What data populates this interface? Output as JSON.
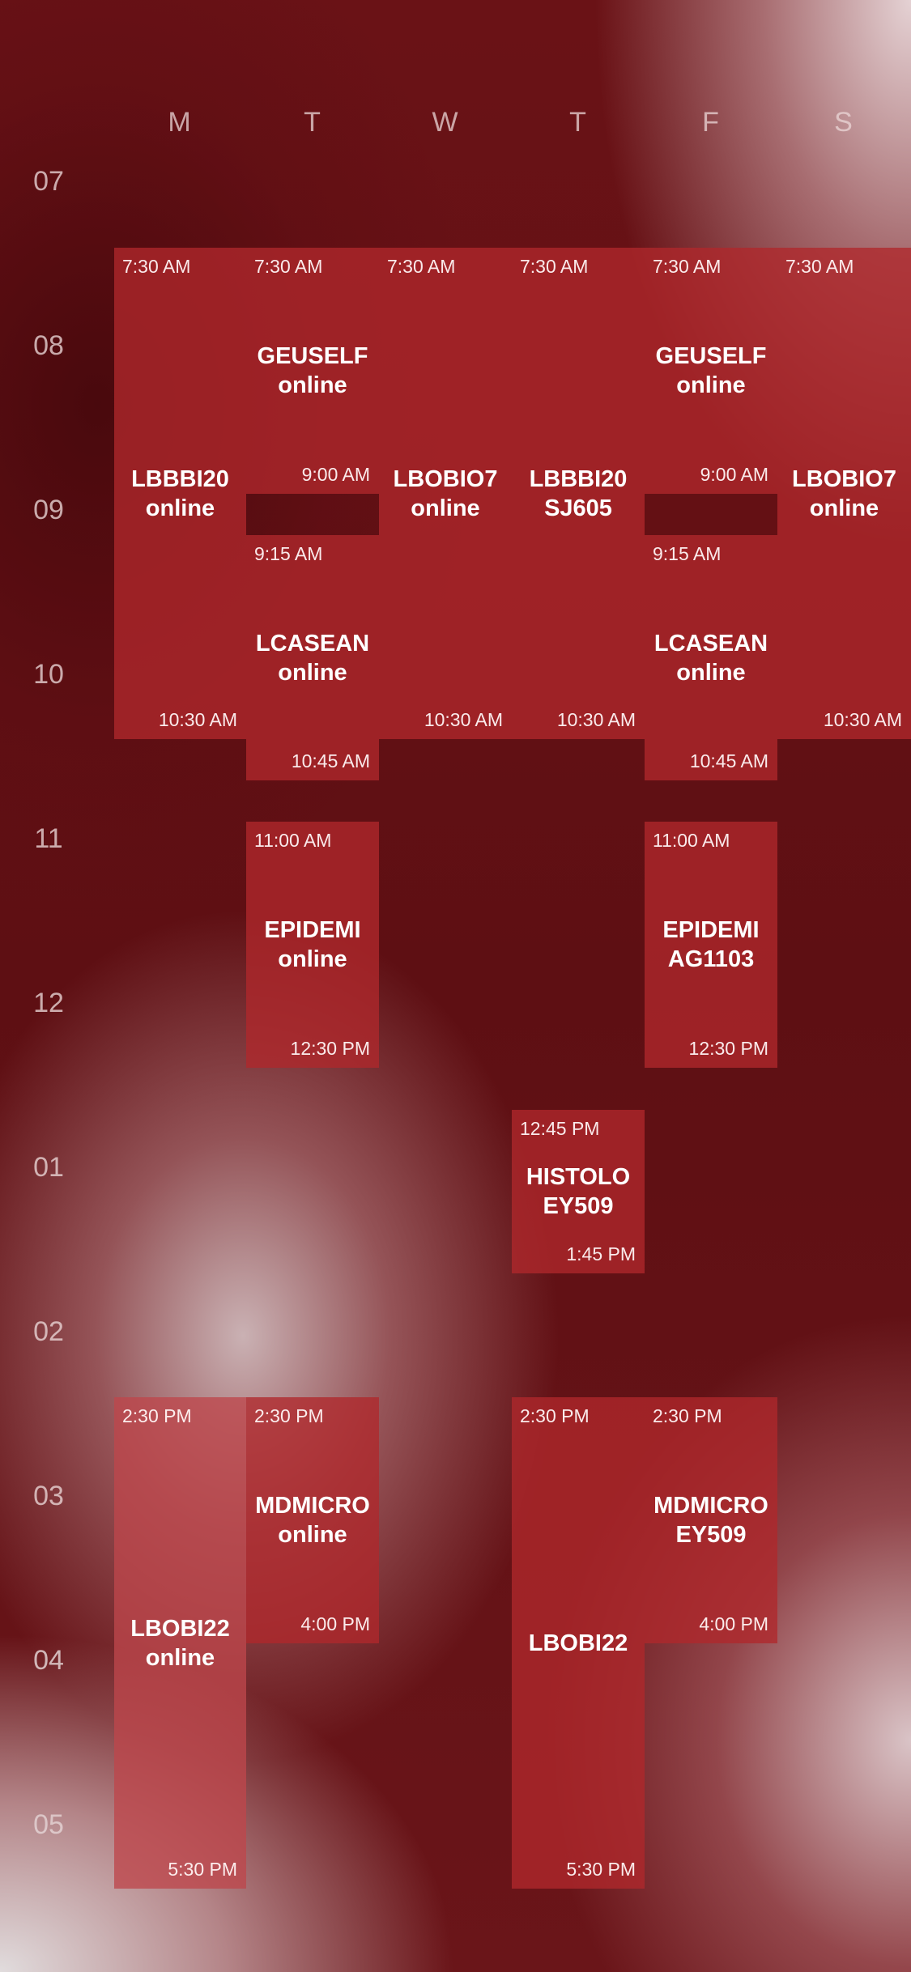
{
  "days": [
    "M",
    "T",
    "W",
    "T",
    "F",
    "S"
  ],
  "hours": [
    "07",
    "08",
    "09",
    "10",
    "11",
    "12",
    "01",
    "02",
    "03",
    "04",
    "05"
  ],
  "events": [
    {
      "day": "M",
      "title_line1": "LBBBI20",
      "title_line2": "online",
      "start": "7:30 AM",
      "end": "10:30 AM"
    },
    {
      "day": "T",
      "title_line1": "GEUSELF",
      "title_line2": "online",
      "start": "7:30 AM",
      "end": "9:00 AM"
    },
    {
      "day": "W",
      "title_line1": "LBOBIO7",
      "title_line2": "online",
      "start": "7:30 AM",
      "end": "10:30 AM"
    },
    {
      "day": "T",
      "title_line1": "LBBBI20",
      "title_line2": "SJ605",
      "start": "7:30 AM",
      "end": "10:30 AM"
    },
    {
      "day": "F",
      "title_line1": "GEUSELF",
      "title_line2": "online",
      "start": "7:30 AM",
      "end": "9:00 AM"
    },
    {
      "day": "S",
      "title_line1": "LBOBIO7",
      "title_line2": "online",
      "start": "7:30 AM",
      "end": "10:30 AM"
    },
    {
      "day": "T",
      "title_line1": "LCASEAN",
      "title_line2": "online",
      "start": "9:15 AM",
      "end": "10:45 AM"
    },
    {
      "day": "F",
      "title_line1": "LCASEAN",
      "title_line2": "online",
      "start": "9:15 AM",
      "end": "10:45 AM"
    },
    {
      "day": "T",
      "title_line1": "EPIDEMI",
      "title_line2": "online",
      "start": "11:00 AM",
      "end": "12:30 PM"
    },
    {
      "day": "F",
      "title_line1": "EPIDEMI",
      "title_line2": "AG1103",
      "start": "11:00 AM",
      "end": "12:30 PM"
    },
    {
      "day": "T",
      "title_line1": "HISTOLO",
      "title_line2": "EY509",
      "start": "12:45 PM",
      "end": "1:45 PM"
    },
    {
      "day": "M",
      "title_line1": "LBOBI22",
      "title_line2": "online",
      "start": "2:30 PM",
      "end": "5:30 PM"
    },
    {
      "day": "T",
      "title_line1": "MDMICRO",
      "title_line2": "online",
      "start": "2:30 PM",
      "end": "4:00 PM"
    },
    {
      "day": "T",
      "title_line1": "LBOBI22",
      "title_line2": "",
      "start": "2:30 PM",
      "end": "5:30 PM"
    },
    {
      "day": "F",
      "title_line1": "MDMICRO",
      "title_line2": "EY509",
      "start": "2:30 PM",
      "end": "4:00 PM"
    }
  ],
  "colors": {
    "event_fill": "#b0282c",
    "background": "#5e0f13",
    "label": "#ebd7d7"
  }
}
